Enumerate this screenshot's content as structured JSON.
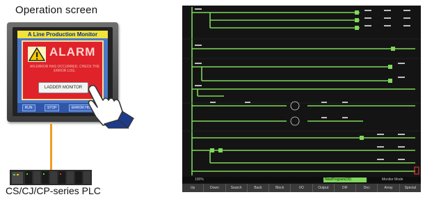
{
  "left_caption": "Operation screen",
  "hmi": {
    "title": "A Line Production Monitor",
    "alarm_label": "ALARM",
    "alarm_message": "AN ERROR HAS OCCURRED. CHECK THE ERROR LOG.",
    "button_label": "LADDER MONITOR",
    "footer_keys": [
      "RUN",
      "STOP",
      "ERROR HISTORY"
    ],
    "colors": {
      "alarm": "#e0222a",
      "screen": "#4a78c8",
      "title_bar": "#f2e33b"
    }
  },
  "plc_label": "CS/CJ/CP-series PLC",
  "ladder_monitor": {
    "program_name": "NewProgram(00)",
    "state": "Monitor Mode",
    "zoom": "100%",
    "toolbar": [
      "Up",
      "Down",
      "Search",
      "Back",
      "Block",
      "I/O",
      "Output",
      "DIF",
      "Dec",
      "Array",
      "Special"
    ],
    "line_color": "#7fd85a"
  }
}
